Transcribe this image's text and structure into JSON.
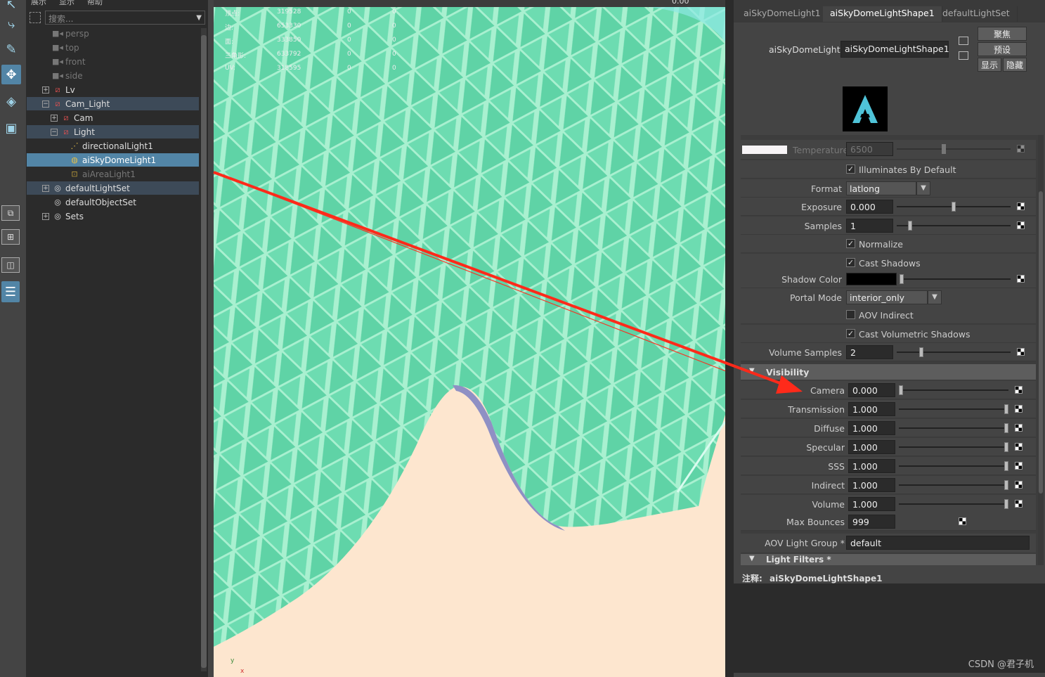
{
  "outliner": {
    "menu": [
      "展示",
      "显示",
      "帮助"
    ],
    "search_placeholder": "搜索...",
    "items": [
      {
        "label": "persp",
        "icon": "camera-icon"
      },
      {
        "label": "top",
        "icon": "camera-icon"
      },
      {
        "label": "front",
        "icon": "camera-icon"
      },
      {
        "label": "side",
        "icon": "camera-icon"
      },
      {
        "label": "Lv",
        "icon": "group-icon"
      },
      {
        "label": "Cam_Light",
        "icon": "group-icon"
      },
      {
        "label": "Cam",
        "icon": "group-icon"
      },
      {
        "label": "Light",
        "icon": "group-icon"
      },
      {
        "label": "directionalLight1",
        "icon": "directional-light-icon"
      },
      {
        "label": "aiSkyDomeLight1",
        "icon": "skydome-light-icon"
      },
      {
        "label": "aiAreaLight1",
        "icon": "area-light-icon"
      },
      {
        "label": "defaultLightSet",
        "icon": "set-icon"
      },
      {
        "label": "defaultObjectSet",
        "icon": "set-icon"
      },
      {
        "label": "Sets",
        "icon": "set-icon"
      }
    ]
  },
  "viewport": {
    "hud": [
      {
        "label": "顶点:",
        "v1": "319528",
        "v2": "0",
        "v3": "0"
      },
      {
        "label": "边:",
        "v1": "653330",
        "v2": "0",
        "v3": "0"
      },
      {
        "label": "面:",
        "v1": "333850",
        "v2": "0",
        "v3": "0"
      },
      {
        "label": "三角形:",
        "v1": "633792",
        "v2": "0",
        "v3": "0"
      },
      {
        "label": "UV:",
        "v1": "318595",
        "v2": "0",
        "v3": "0"
      }
    ],
    "zoom_value": "0.00",
    "axis_y": "y",
    "axis_x": "x"
  },
  "attribute_editor": {
    "tabs": [
      "aiSkyDomeLight1",
      "aiSkyDomeLightShape1",
      "defaultLightSet"
    ],
    "node_label": "aiSkyDomeLight:",
    "node_value": "aiSkyDomeLightShape1",
    "buttons": {
      "focus": "聚焦",
      "presets": "预设",
      "show": "显示",
      "hide": "隐藏"
    },
    "temperature_label": "Temperature",
    "temperature_value": "6500",
    "illuminates_default": "Illuminates By Default",
    "format_label": "Format",
    "format_value": "latlong",
    "exposure_label": "Exposure",
    "exposure_value": "0.000",
    "samples_label": "Samples",
    "samples_value": "1",
    "normalize": "Normalize",
    "cast_shadows": "Cast Shadows",
    "shadow_color_label": "Shadow Color",
    "portal_mode_label": "Portal Mode",
    "portal_mode_value": "interior_only",
    "aov_indirect": "AOV Indirect",
    "cast_volumetric": "Cast Volumetric Shadows",
    "volume_samples_label": "Volume Samples",
    "volume_samples_value": "2",
    "visibility_section": "Visibility",
    "visibility": [
      {
        "label": "Camera",
        "value": "0.000",
        "level": 0.0
      },
      {
        "label": "Transmission",
        "value": "1.000",
        "level": 1.0
      },
      {
        "label": "Diffuse",
        "value": "1.000",
        "level": 1.0
      },
      {
        "label": "Specular",
        "value": "1.000",
        "level": 1.0
      },
      {
        "label": "SSS",
        "value": "1.000",
        "level": 1.0
      },
      {
        "label": "Indirect",
        "value": "1.000",
        "level": 1.0
      },
      {
        "label": "Volume",
        "value": "1.000",
        "level": 1.0
      }
    ],
    "max_bounces_label": "Max Bounces",
    "max_bounces_value": "999",
    "aov_light_group_label": "AOV Light Group *",
    "aov_light_group_value": "default",
    "light_filters_section": "Light Filters *",
    "notes_label": "注释:",
    "notes_value": "aiSkyDomeLightShape1"
  },
  "watermark": "CSDN @君子机",
  "colors": {
    "accent": "#5285a6",
    "mesh": "#7de3be",
    "arrow": "#ff2a1a"
  }
}
